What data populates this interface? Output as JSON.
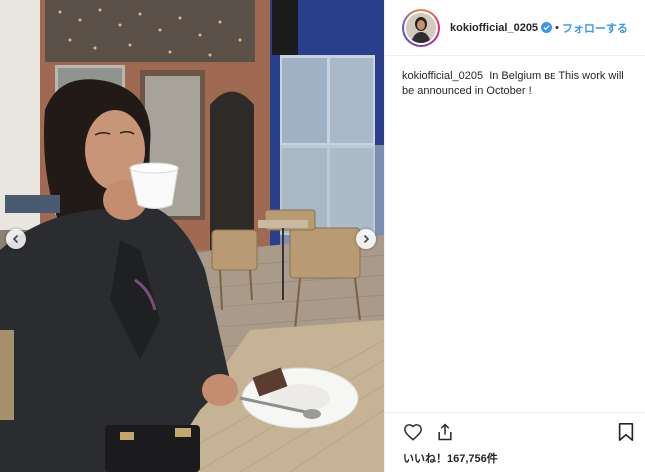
{
  "post": {
    "username": "kokiofficial_0205",
    "follow_label": "フォローする",
    "separator": "•",
    "caption": {
      "username": "kokiofficial_0205",
      "text": "In Belgium ʙᴇ This work will be announced in October !"
    },
    "likes": {
      "label": "いいね！",
      "count": "167,756件"
    }
  },
  "icons": {
    "verified": "verified-badge-icon",
    "like": "heart-icon",
    "share": "share-icon",
    "save": "bookmark-icon",
    "prev": "chevron-left-icon",
    "next": "chevron-right-icon"
  },
  "colors": {
    "follow_blue": "#3897f0",
    "verified_blue": "#3897f0",
    "text": "#262626"
  }
}
